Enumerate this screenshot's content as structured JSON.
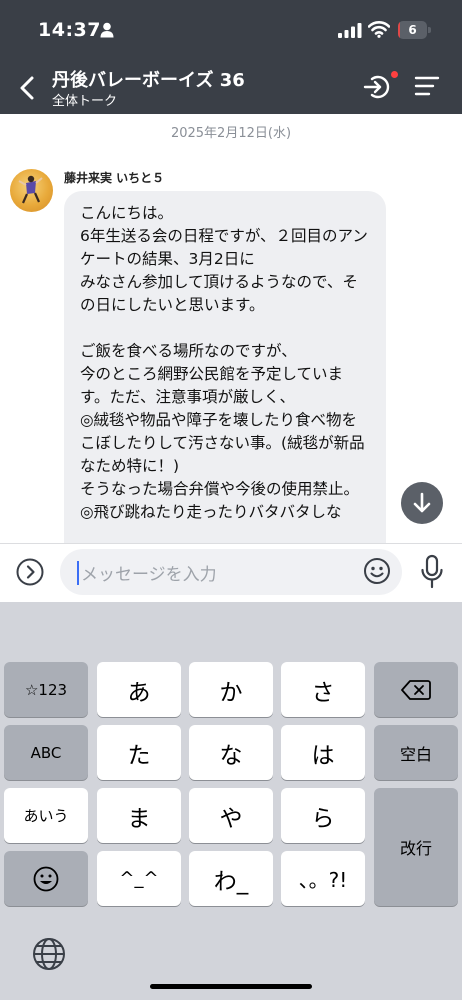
{
  "status_bar": {
    "time": "14:37",
    "battery": "6",
    "battery_level": 0.06
  },
  "header": {
    "title": "丹後バレーボーイズ 36",
    "subtitle": "全体トーク",
    "accent_color": "#3a3f47"
  },
  "chat": {
    "date": "2025年2月12日(水)",
    "message": {
      "sender": "藤井来実 いちと５",
      "text": "こんにちは。\n6年生送る会の日程ですが、２回目のアンケートの結果、3月2日に\nみなさん参加して頂けるようなので、その日にしたいと思います。\n\nご飯を食べる場所なのですが、\n今のところ網野公民館を予定しています。ただ、注意事項が厳しく、\n◎絨毯や物品や障子を壊したり食べ物をこぼしたりして汚さない事。(絨毯が新品なため特に！)\nそうなった場合弁償や今後の使用禁止。\n◎飛び跳ねたり走ったりバタバタしな"
    }
  },
  "input": {
    "placeholder": "メッセージを入力"
  },
  "keyboard": {
    "keys": {
      "mode_123": "☆123",
      "mode_abc": "ABC",
      "mode_kana": "あいう",
      "a": "あ",
      "ka": "か",
      "sa": "さ",
      "ta": "た",
      "na": "な",
      "ha": "は",
      "ma": "ま",
      "ya": "や",
      "ra": "ら",
      "emoticon": "^_^",
      "wa": "わ_",
      "punct": "、。?!",
      "space": "空白",
      "return": "改行"
    }
  },
  "icons": [
    "person-icon",
    "signal-icon",
    "wifi-icon",
    "back-icon",
    "join-icon",
    "menu-icon",
    "arrow-down-icon",
    "chevron-right-icon",
    "emoji-icon",
    "mic-icon",
    "backspace-icon",
    "emoji-face-icon",
    "globe-icon"
  ]
}
